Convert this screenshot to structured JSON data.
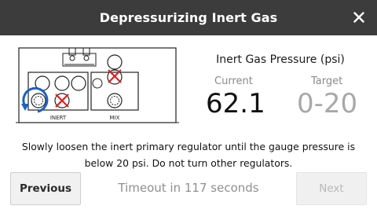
{
  "dialog": {
    "title": "Depressurizing Inert Gas"
  },
  "diagram": {
    "left_label": "INERT",
    "right_label": "MIX"
  },
  "pressure": {
    "heading": "Inert Gas Pressure (psi)",
    "current_label": "Current",
    "target_label": "Target",
    "current_value": "62.1",
    "target_value": "0-20"
  },
  "instruction": {
    "line1": "Slowly loosen the inert primary regulator until the gauge pressure is",
    "line2": "below 20 psi. Do not turn other regulators."
  },
  "footer": {
    "previous_label": "Previous",
    "timeout_text": "Timeout in 117 seconds",
    "next_label": "Next"
  },
  "colors": {
    "header_bg": "#3c3c3c",
    "accent_blue": "#1f5fbf",
    "mark_red": "#e02020"
  }
}
